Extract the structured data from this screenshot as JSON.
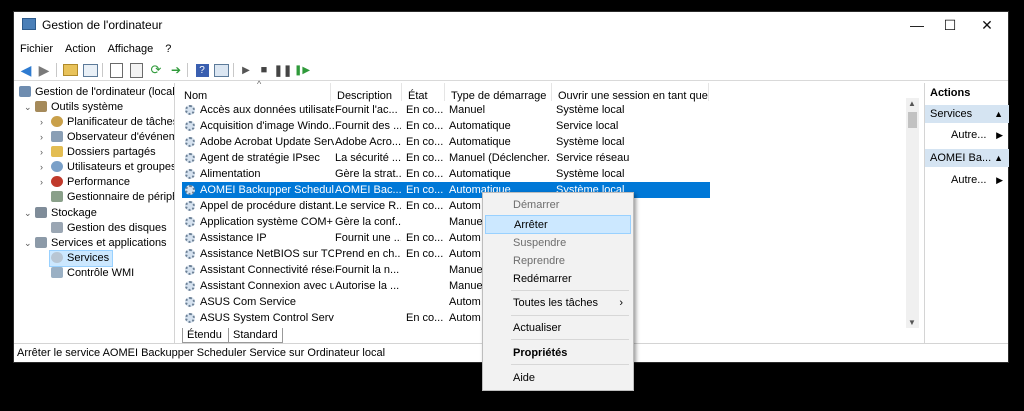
{
  "window": {
    "title": "Gestion de l'ordinateur",
    "controls": {
      "minimize": "—",
      "maximize": "☐",
      "close": "✕"
    }
  },
  "menu": [
    "Fichier",
    "Action",
    "Affichage",
    "?"
  ],
  "toolbar": [
    "back-icon",
    "forward-icon",
    "folder-up-icon",
    "console-tree-icon",
    "properties-icon",
    "export-list-icon",
    "refresh-icon",
    "export-icon",
    "help-icon",
    "show-hide-icon",
    "play-icon",
    "stop-icon",
    "pause-icon",
    "restart-icon"
  ],
  "tree": {
    "root": "Gestion de l'ordinateur (local)",
    "system_tools": "Outils système",
    "items": [
      "Planificateur de tâches",
      "Observateur d'événeme",
      "Dossiers partagés",
      "Utilisateurs et groupes l",
      "Performance",
      "Gestionnaire de périphé"
    ],
    "storage": "Stockage",
    "disk_mgmt": "Gestion des disques",
    "services_apps": "Services et applications",
    "services": "Services",
    "wmi": "Contrôle WMI"
  },
  "table": {
    "columns": [
      "Nom",
      "Description",
      "État",
      "Type de démarrage",
      "Ouvrir une session en tant que"
    ],
    "sort_indicator": "^",
    "rows": [
      [
        "Accès aux données utilisate...",
        "Fournit l'ac...",
        "En co...",
        "Manuel",
        "Système local"
      ],
      [
        "Acquisition d'image Windo...",
        "Fournit des ...",
        "En co...",
        "Automatique",
        "Service local"
      ],
      [
        "Adobe Acrobat Update Serv...",
        "Adobe Acro...",
        "En co...",
        "Automatique",
        "Système local"
      ],
      [
        "Agent de stratégie IPsec",
        "La sécurité ...",
        "En co...",
        "Manuel (Déclencher...",
        "Service réseau"
      ],
      [
        "Alimentation",
        "Gère la strat...",
        "En co...",
        "Automatique",
        "Système local"
      ],
      [
        "AOMEI Backupper Schedule...",
        "AOMEI Bac...",
        "En co...",
        "Automatique",
        "Système local"
      ],
      [
        "Appel de procédure distant...",
        "Le service R...",
        "En co...",
        "Autom",
        ""
      ],
      [
        "Application système COM+",
        "Gère la conf...",
        "",
        "Manue",
        ""
      ],
      [
        "Assistance IP",
        "Fournit une ...",
        "En co...",
        "Autom",
        ""
      ],
      [
        "Assistance NetBIOS sur TCP...",
        "Prend en ch...",
        "En co...",
        "Autom",
        ""
      ],
      [
        "Assistant Connectivité réseau",
        "Fournit la n...",
        "",
        "Manue",
        ""
      ],
      [
        "Assistant Connexion avec u...",
        "Autorise la ...",
        "",
        "Manue",
        ""
      ],
      [
        "ASUS Com Service",
        "",
        "",
        "Autom",
        ""
      ],
      [
        "ASUS System Control Service",
        "",
        "En co...",
        "Autom",
        ""
      ]
    ],
    "selected_index": 5
  },
  "tabs": [
    "Étendu",
    "Standard"
  ],
  "actions": {
    "header": "Actions",
    "section1": "Services",
    "item1": "Autre...",
    "section2": "AOMEI Ba...",
    "item2": "Autre..."
  },
  "status": "Arrêter le service AOMEI Backupper Scheduler Service sur Ordinateur local",
  "context_menu": {
    "items": [
      {
        "label": "Démarrer",
        "disabled": true
      },
      {
        "label": "Arrêter",
        "highlight": true
      },
      {
        "label": "Suspendre",
        "disabled": true
      },
      {
        "label": "Reprendre",
        "disabled": true
      },
      {
        "label": "Redémarrer"
      },
      {
        "label": "Toutes les tâches",
        "submenu": true
      },
      {
        "label": "Actualiser"
      },
      {
        "label": "Propriétés",
        "bold": true
      },
      {
        "label": "Aide"
      }
    ],
    "submenu_arrow": "›"
  },
  "colors": {
    "selection": "#0078d7",
    "hover": "#cce8ff"
  }
}
